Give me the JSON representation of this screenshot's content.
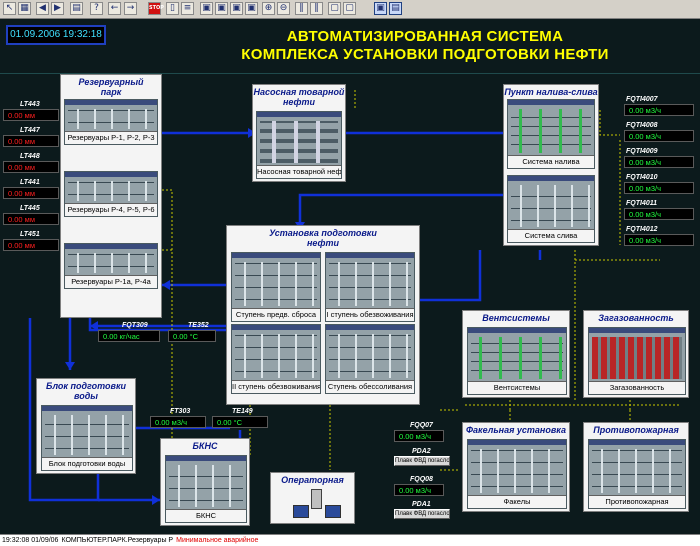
{
  "datetime": "01.09.2006 19:32:18",
  "title": {
    "line1": "АВТОМАТИЗИРОВАННАЯ СИСТЕМА",
    "line2": "КОМПЛЕКСА УСТАНОВКИ ПОДГОТОВКИ НЕФТИ"
  },
  "colors": {
    "flow_line": "#1030d8",
    "alarm_red": "#ff2020",
    "ok_green": "#20ff40",
    "title_yellow": "#ffff00"
  },
  "toolbar_icons": [
    "pointer-icon",
    "grid-icon",
    "back-icon",
    "forward-icon",
    "print-icon",
    "stop-icon",
    "window-icon",
    "window-icon",
    "window-icon",
    "window-icon",
    "zoom-icon",
    "zoom-icon",
    "pause-icon",
    "pause-icon",
    "frame-icon",
    "frame-icon",
    "save-icon",
    "help-icon"
  ],
  "reservoir_park": {
    "title_line1": "Резервуарный",
    "title_line2": "парк",
    "thumbs": [
      "Резервуары Р-1, Р-2, Р-3",
      "Резервуары Р-4, Р-5, Р-6",
      "Резервуары Р-1а, Р-4а"
    ]
  },
  "left_sensors": [
    {
      "tag": "LT443",
      "value": "0.00 мм"
    },
    {
      "tag": "LT447",
      "value": "0.00 мм"
    },
    {
      "tag": "LT448",
      "value": "0.00 мм"
    },
    {
      "tag": "LT441",
      "value": "0.00 мм"
    },
    {
      "tag": "LT445",
      "value": "0.00 мм"
    },
    {
      "tag": "LT451",
      "value": "0.00 мм"
    }
  ],
  "pump_station": {
    "title_line1": "Насосная товарной",
    "title_line2": "нефти",
    "caption": "Насосная товарной нефти"
  },
  "loading_point": {
    "title": "Пункт налива-слива",
    "thumbs": [
      "Система налива",
      "Система слива"
    ]
  },
  "right_sensors": [
    {
      "tag": "FQTI4007",
      "value": "0.00 м3/ч"
    },
    {
      "tag": "FQTI4008",
      "value": "0.00 м3/ч"
    },
    {
      "tag": "FQTI4009",
      "value": "0.00 м3/ч"
    },
    {
      "tag": "FQTI4010",
      "value": "0.00 м3/ч"
    },
    {
      "tag": "FQTI4011",
      "value": "0.00 м3/ч"
    },
    {
      "tag": "FQTI4012",
      "value": "0.00 м3/ч"
    }
  ],
  "prep_unit": {
    "title_line1": "Установка подготовки",
    "title_line2": "нефти",
    "thumbs": [
      "Ступень предв. сброса",
      "I ступень обезвоживания",
      "II ступень обезвоживания",
      "Ступень обессоливания"
    ]
  },
  "mid_sensors": [
    {
      "tag": "FQT309",
      "value": "0.00 кг/час"
    },
    {
      "tag": "TE352",
      "value": "0.00 °C"
    }
  ],
  "water_unit": {
    "title_line1": "Блок подготовки",
    "title_line2": "воды",
    "caption": "Блок подготовки воды"
  },
  "water_sensors": [
    {
      "tag": "FT303",
      "value": "0.00 м3/ч"
    },
    {
      "tag": "TE149",
      "value": "0.00 °C"
    }
  ],
  "bkns": {
    "title": "БКНС",
    "caption": "БКНС"
  },
  "operator": {
    "title": "Операторная"
  },
  "ventilation": {
    "title": "Вентсистемы",
    "caption": "Вентсистемы"
  },
  "gas": {
    "title": "Загазованность",
    "caption": "Загазованность"
  },
  "flare": {
    "title": "Факельная установка",
    "caption": "Факелы",
    "sensors": [
      {
        "tag": "FQQ07",
        "value": "0.00 м3/ч",
        "pda": "PDA2",
        "button": "Плавк ФВД погасло"
      },
      {
        "tag": "FQQ08",
        "value": "0.00 м3/ч",
        "pda": "PDA1",
        "button": "Плавк ФВД погасло"
      }
    ]
  },
  "fire": {
    "title": "Противопожарная",
    "caption": "Противопожарная"
  },
  "status_bar": {
    "time": "19:32:08 01/09/06",
    "source": "КОМПЬЮТЕР.ПАРК.Резервуары Р",
    "message": "Минимальное аварийное"
  }
}
